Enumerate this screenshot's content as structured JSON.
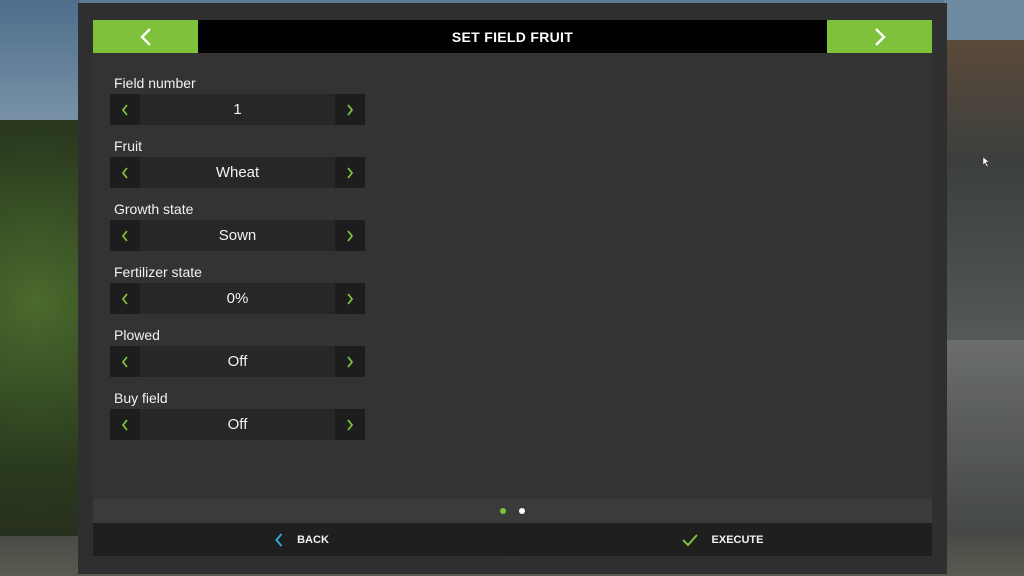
{
  "header": {
    "title": "SET FIELD FRUIT"
  },
  "fields": [
    {
      "label": "Field number",
      "value": "1"
    },
    {
      "label": "Fruit",
      "value": "Wheat"
    },
    {
      "label": "Growth state",
      "value": "Sown"
    },
    {
      "label": "Fertilizer state",
      "value": "0%"
    },
    {
      "label": "Plowed",
      "value": "Off"
    },
    {
      "label": "Buy field",
      "value": "Off"
    }
  ],
  "pager": {
    "active_page": 1,
    "total_pages": 2
  },
  "footer": {
    "back_label": "BACK",
    "execute_label": "EXECUTE"
  },
  "colors": {
    "accent": "#7ec13a",
    "back_icon": "#2fa7d8",
    "execute_icon": "#7ec13a"
  },
  "icons": {
    "prev_page": "chevron-left-icon",
    "next_page": "chevron-right-icon",
    "back": "chevron-left-icon",
    "execute": "checkmark-icon"
  }
}
